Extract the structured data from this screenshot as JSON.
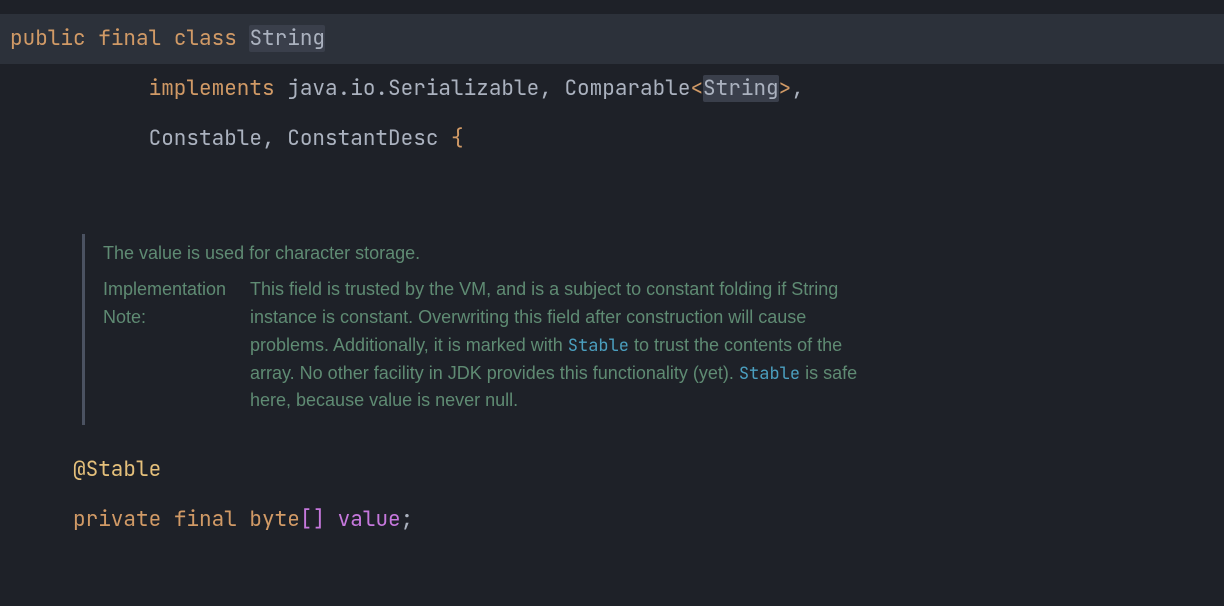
{
  "colors": {
    "background": "#1e2128",
    "current_line": "#2c313a",
    "keyword": "#d19a66",
    "text": "#abb2bf",
    "highlight_bg": "#3a3f4b",
    "annotation": "#e5c07b",
    "identifier_purple": "#c678dd",
    "doc_text": "#5f8b73",
    "doc_code_link": "#4b9fbf",
    "doc_border": "#4b5261"
  },
  "code": {
    "line1": {
      "kw_public": "public",
      "kw_final": "final",
      "kw_class": "class",
      "class_name": "String"
    },
    "line2": {
      "kw_implements": "implements",
      "impl_serializable": "java.io.Serializable",
      "comma1": ",",
      "impl_comparable": "Comparable",
      "lt": "<",
      "generic_type": "String",
      "gt": ">",
      "comma2": ","
    },
    "line3": {
      "impl_constable": "Constable",
      "comma": ",",
      "impl_constantdesc": "ConstantDesc",
      "brace_open": "{"
    },
    "annotation_line": {
      "annotation": "@Stable"
    },
    "field_line": {
      "kw_private": "private",
      "kw_final": "final",
      "type": "byte",
      "brackets_open": "[",
      "brackets_close": "]",
      "name": "value",
      "semicolon": ";"
    }
  },
  "doc": {
    "summary": "The value is used for character storage.",
    "note_label": "Implementation Note:",
    "note_body_1": "This field is trusted by the VM, and is a subject to constant folding if String instance is constant. Overwriting this field after construction will cause problems. Additionally, it is marked with ",
    "note_code_1": "Stable",
    "note_body_2": " to trust the contents of the array. No other facility in JDK provides this functionality (yet). ",
    "note_code_2": "Stable",
    "note_body_3": " is safe here, because value is never null."
  }
}
